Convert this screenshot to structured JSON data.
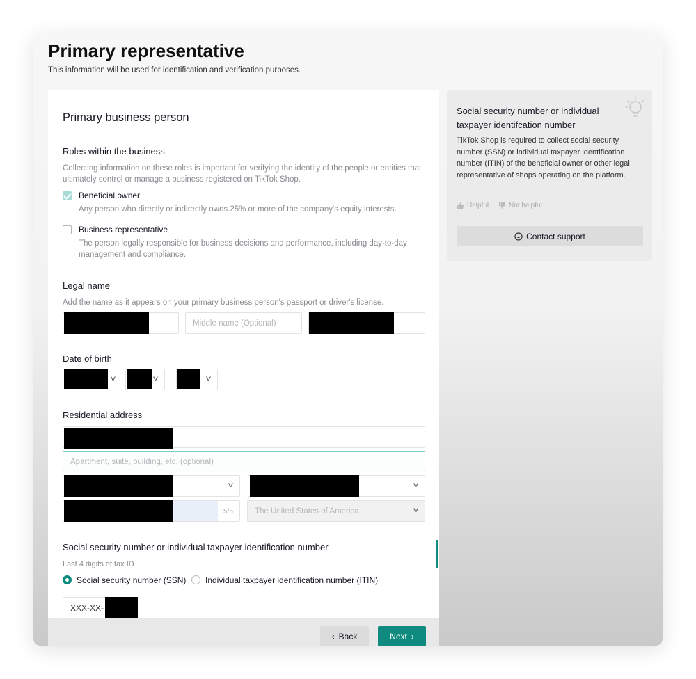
{
  "header": {
    "title": "Primary representative",
    "subtitle": "This information will be used for identification and verification purposes."
  },
  "form": {
    "section_title": "Primary business person",
    "roles": {
      "label": "Roles within the business",
      "help": "Collecting information on these roles is important for verifying the identity of the people or entities that ultimately control or manage a business registered on TikTok Shop.",
      "options": [
        {
          "label": "Beneficial owner",
          "help": "Any person who directly or indirectly owns 25% or more of the company's equity interests.",
          "checked": true
        },
        {
          "label": "Business representative",
          "help": "The person legally responsible for business decisions and performance, including day-to-day management and compliance.",
          "checked": false
        }
      ]
    },
    "legal_name": {
      "label": "Legal name",
      "help": "Add the name as it appears on your primary business person's passport or driver's license.",
      "middle_placeholder": "Middle name (Optional)"
    },
    "dob": {
      "label": "Date of birth"
    },
    "address": {
      "label": "Residential address",
      "line2_placeholder": "Apartment, suite, building, etc. (optional)",
      "zip_counter": "5/5",
      "country": "The United States of America"
    },
    "tax": {
      "label": "Social security number or individual taxpayer identification number",
      "sublabel": "Last 4 digits of tax ID",
      "options": [
        {
          "label": "Social security number (SSN)",
          "selected": true
        },
        {
          "label": "Individual taxpayer identification number (ITIN)",
          "selected": false
        }
      ],
      "prefix": "XXX-XX-"
    },
    "buttons": {
      "back": "Back",
      "next": "Next"
    }
  },
  "side": {
    "title": "Social security number or individual taxpayer identifcation number",
    "body": "TikTok Shop is required to collect social security number (SSN) or individual taxpayer identification number (ITIN) of the beneficial owner or other legal representative of shops operating on the platform.",
    "helpful": "Helpful",
    "not_helpful": "Not helpful",
    "support": "Contact support"
  },
  "colors": {
    "accent": "#0f8a7e",
    "checkbox_checked": "#a7dcd6"
  }
}
